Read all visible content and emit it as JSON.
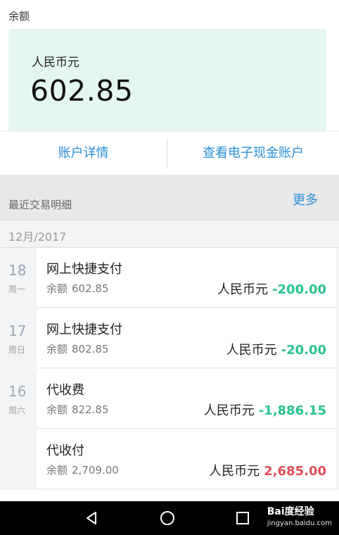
{
  "balance_section": {
    "label": "余额",
    "currency": "人民币元",
    "amount": "602.85",
    "card_color": "#e3f6f1"
  },
  "actions": {
    "account_details": "账户详情",
    "view_e_cash": "查看电子现金账户",
    "accent_color": "#2a8fd8"
  },
  "recent": {
    "title": "最近交易明细",
    "more": "更多",
    "month": "12月/2017"
  },
  "transactions": [
    {
      "day": "18",
      "weekday": "周一",
      "name": "网上快捷支付",
      "balance_label": "余额",
      "balance": "602.85",
      "currency": "人民币元",
      "amount": "-200.00",
      "type": "neg"
    },
    {
      "day": "17",
      "weekday": "周日",
      "name": "网上快捷支付",
      "balance_label": "余额",
      "balance": "802.85",
      "currency": "人民币元",
      "amount": "-20.00",
      "type": "neg"
    },
    {
      "day": "16",
      "weekday": "周六",
      "name": "代收费",
      "balance_label": "余额",
      "balance": "822.85",
      "currency": "人民币元",
      "amount": "-1,886.15",
      "type": "neg"
    },
    {
      "day": "",
      "weekday": "",
      "name": "代收付",
      "balance_label": "余额",
      "balance": "2,709.00",
      "currency": "人民币元",
      "amount": "2,685.00",
      "type": "pos"
    }
  ],
  "colors": {
    "debit": "#29c28f",
    "credit": "#e14e5a"
  },
  "nav": {
    "back_icon": "triangle-back-icon",
    "home_icon": "circle-home-icon",
    "recent_icon": "square-recent-icon"
  },
  "watermark": {
    "brand": "Bai度经验",
    "url": "jingyan.baidu.com"
  }
}
